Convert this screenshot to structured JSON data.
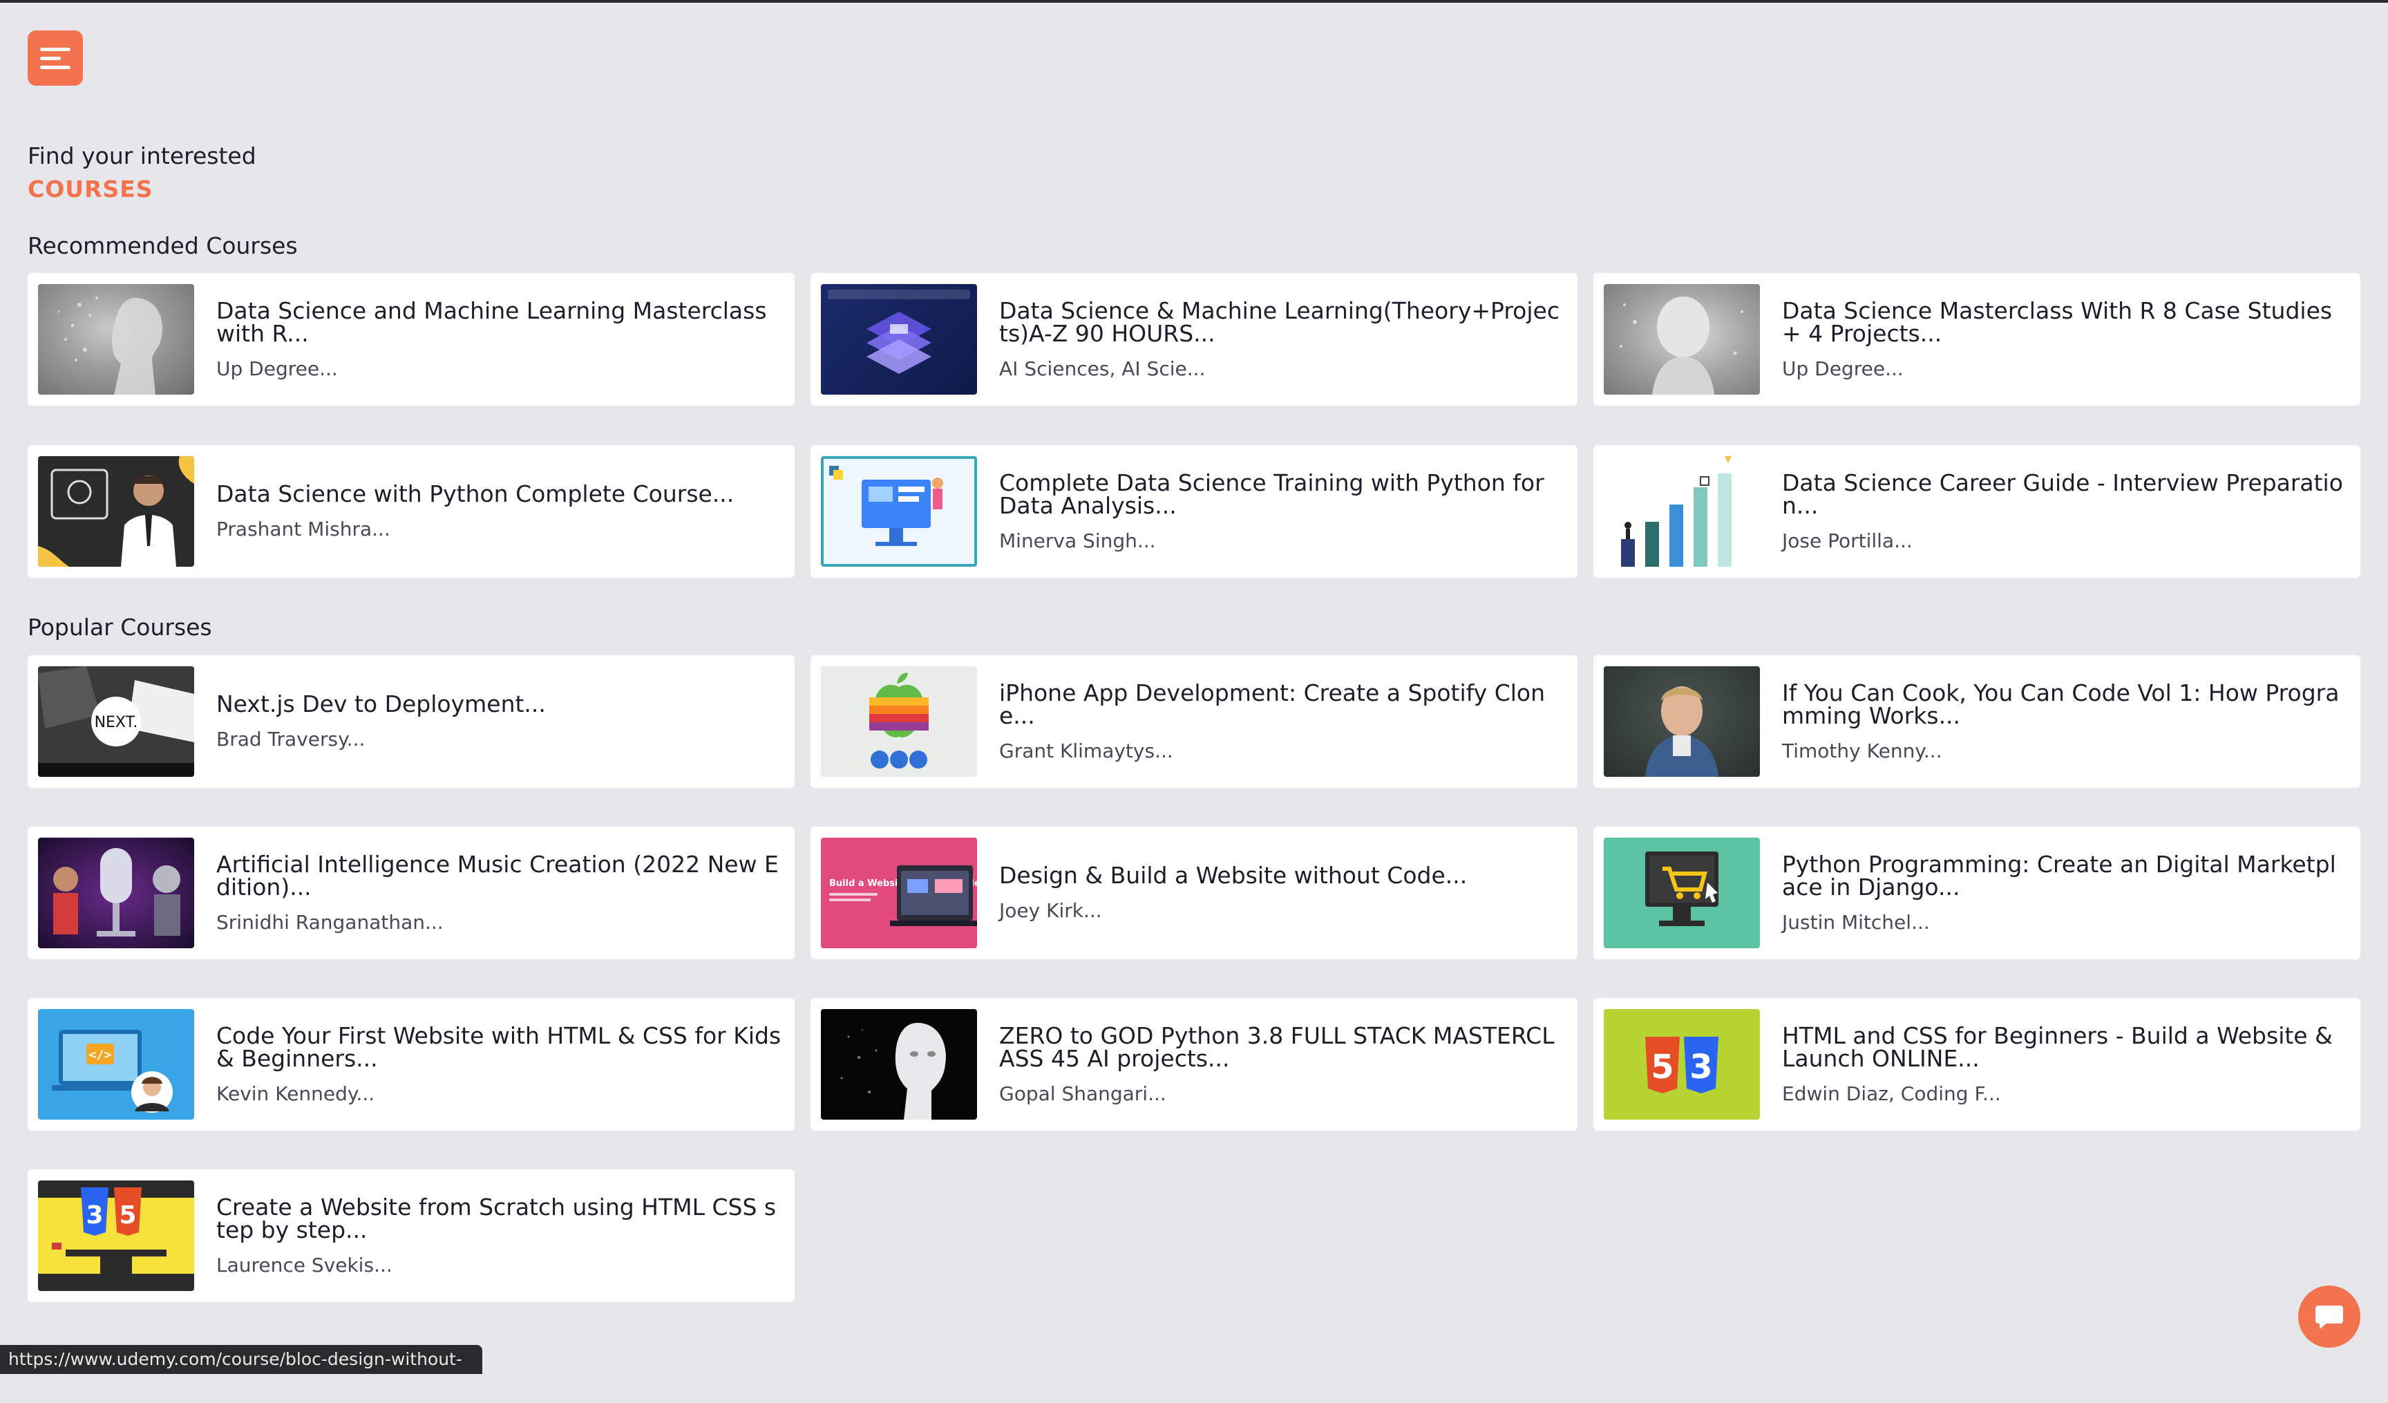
{
  "header": {
    "find_label": "Find your interested",
    "courses_label": "COURSES",
    "menu_icon": "hamburger-menu-icon"
  },
  "sections": {
    "recommended": "Recommended Courses",
    "popular": "Popular Courses"
  },
  "recommended": [
    {
      "title": "Data Science and Machine Learning Masterclass with R...",
      "author": "Up Degree..."
    },
    {
      "title": "Data Science & Machine Learning(Theory+Projects)A-Z 90 HOURS...",
      "author": "AI Sciences, AI Scie..."
    },
    {
      "title": "Data Science Masterclass With R 8 Case Studies + 4 Projects...",
      "author": "Up Degree..."
    },
    {
      "title": "Data Science with Python Complete Course...",
      "author": "Prashant Mishra..."
    },
    {
      "title": "Complete Data Science Training with Python for Data Analysis...",
      "author": "Minerva Singh..."
    },
    {
      "title": "Data Science Career Guide - Interview Preparation...",
      "author": "Jose Portilla..."
    }
  ],
  "popular": [
    {
      "title": "Next.js Dev to Deployment...",
      "author": "Brad Traversy..."
    },
    {
      "title": "iPhone App Development: Create a Spotify Clone...",
      "author": "Grant Klimaytys..."
    },
    {
      "title": "If You Can Cook, You Can Code Vol 1: How Programming Works...",
      "author": "Timothy Kenny..."
    },
    {
      "title": "Artificial Intelligence Music Creation (2022 New Edition)...",
      "author": "Srinidhi Ranganathan..."
    },
    {
      "title": "Design & Build a Website without Code...",
      "author": "Joey Kirk..."
    },
    {
      "title": "Python Programming: Create an Digital Marketplace in Django...",
      "author": "Justin Mitchel..."
    },
    {
      "title": "Code Your First Website with HTML & CSS for Kids & Beginners...",
      "author": "Kevin Kennedy..."
    },
    {
      "title": "ZERO to GOD Python 3.8 FULL STACK MASTERCLASS 45 AI projects...",
      "author": "Gopal Shangari..."
    },
    {
      "title": "HTML and CSS for Beginners - Build a Website & Launch ONLINE...",
      "author": "Edwin Diaz, Coding F..."
    },
    {
      "title": "Create a Website from Scratch using HTML CSS step by step...",
      "author": "Laurence Svekis..."
    }
  ],
  "thumbnails": {
    "next_text": "NEXT.",
    "html5_number": "5",
    "css3_number": "3",
    "bloc_text": "Build a Website Without Code"
  },
  "chat": {
    "icon": "chat-bubble-icon"
  },
  "status_bar": {
    "url": "https://www.udemy.com/course/bloc-design-without-code/"
  },
  "colors": {
    "accent": "#f2734e",
    "background": "#e7e6ea",
    "card": "#ffffff",
    "text": "#1f1d2b"
  }
}
